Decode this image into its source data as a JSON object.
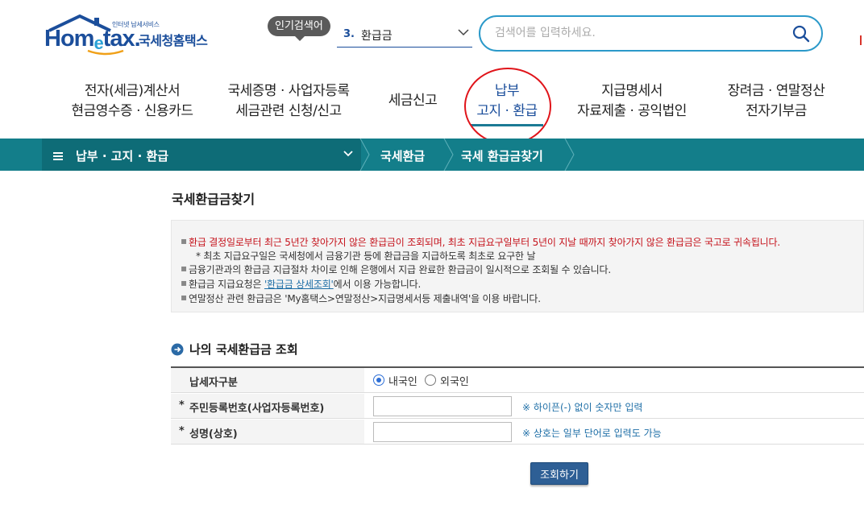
{
  "header": {
    "logo_small": "인터넷 납세서비스",
    "logo_brand_home": "Hom",
    "logo_brand_e": "e",
    "logo_brand_tax": "tax.",
    "logo_korean": "국세청홈택스",
    "popular_label": "인기검색어",
    "popular_rank": "3.",
    "popular_term": "환급금",
    "search_placeholder": "검색어를 입력하세요."
  },
  "main_menu": [
    {
      "line1": "전자(세금)계산서",
      "line2": "현금영수증 · 신용카드"
    },
    {
      "line1": "국세증명 · 사업자등록",
      "line2": "세금관련 신청/신고"
    },
    {
      "line1": "세금신고",
      "line2": ""
    },
    {
      "line1": "납부",
      "line2": "고지 · 환급",
      "active": true
    },
    {
      "line1": "지급명세서",
      "line2": "자료제출 · 공익법인"
    },
    {
      "line1": "장려금 · 연말정산",
      "line2": "전자기부금"
    }
  ],
  "breadcrumb": {
    "menu_glyph": "≡",
    "level1": "납부 · 고지 · 환급",
    "level2": "국세환급",
    "level3": "국세 환급금찾기"
  },
  "page_title": "국세환급금찾기",
  "notices": [
    {
      "text": "환급 결정일로부터 최근 5년간 찾아가지 않은 환급금이 조회되며, 최초 지급요구일부터 5년이 지날 때까지 찾아가지 않은 환급금은 국고로 귀속됩니다.",
      "style": "red"
    },
    {
      "text": "* 최초 지급요구일은 국세청에서 금융기관 등에 환급금을 지급하도록 최초로 요구한 날",
      "style": "sub"
    },
    {
      "text": "금융기관과의 환급금 지급절차 차이로 인해 은행에서 지급 완료한 환급금이 일시적으로 조회될 수 있습니다.",
      "style": "normal"
    },
    {
      "prefix": "환급금 지급요청은 ",
      "link": "'환급금 상세조회'",
      "suffix": "에서 이용 가능합니다.",
      "style": "link"
    },
    {
      "text": "연말정산 관련 환급금은 'My홈택스>연말정산>지급명세서등 제출내역'을 이용 바랍니다.",
      "style": "normal"
    }
  ],
  "bullet_glyph": "▪",
  "section_title": "나의 국세환급금 조회",
  "form": {
    "taxpayer_type_label": "납세자구분",
    "option_domestic": "내국인",
    "option_foreign": "외국인",
    "selected": "내국인",
    "required_mark": "*",
    "id_label": "주민등록번호(사업자등록번호)",
    "id_value": "",
    "id_hint": "※ 하이픈(-) 없이 숫자만 입력",
    "name_label": "성명(상호)",
    "name_value": "",
    "name_hint": "※ 상호는 일부 단어로 입력도 가능",
    "submit_label": "조회하기"
  },
  "colors": {
    "brand_blue": "#1b4e9b",
    "teal_bar": "#137e8a",
    "notice_red": "#c5121b",
    "highlight_circle": "#e0141a",
    "button": "#2e5f95"
  }
}
